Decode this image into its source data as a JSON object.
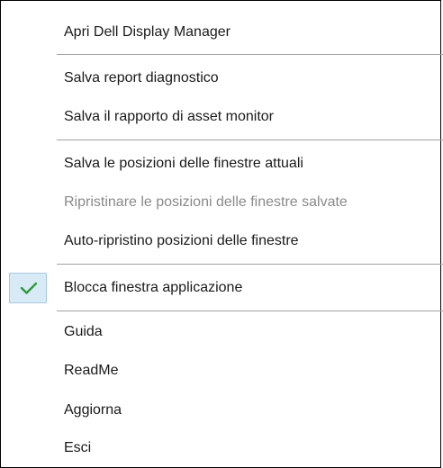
{
  "menu": {
    "items": [
      {
        "label": "Apri Dell Display Manager",
        "enabled": true
      },
      {
        "label": "Salva report diagnostico",
        "enabled": true
      },
      {
        "label": "Salva il rapporto di asset monitor",
        "enabled": true
      },
      {
        "label": "Salva le posizioni delle finestre attuali",
        "enabled": true
      },
      {
        "label": "Ripristinare le posizioni delle finestre salvate",
        "enabled": false
      },
      {
        "label": "Auto-ripristino posizioni delle finestre",
        "enabled": true
      },
      {
        "label": "Blocca finestra applicazione",
        "enabled": true,
        "checked": true
      },
      {
        "label": "Guida",
        "enabled": true
      },
      {
        "label": "ReadMe",
        "enabled": true
      },
      {
        "label": "Aggiorna",
        "enabled": true
      },
      {
        "label": "Esci",
        "enabled": true
      }
    ]
  },
  "colors": {
    "check": "#2e9a3a",
    "disabled_text": "#8a8a8a",
    "separator": "#a0a0a0"
  },
  "icons": {
    "checkmark": "checkmark-icon"
  }
}
